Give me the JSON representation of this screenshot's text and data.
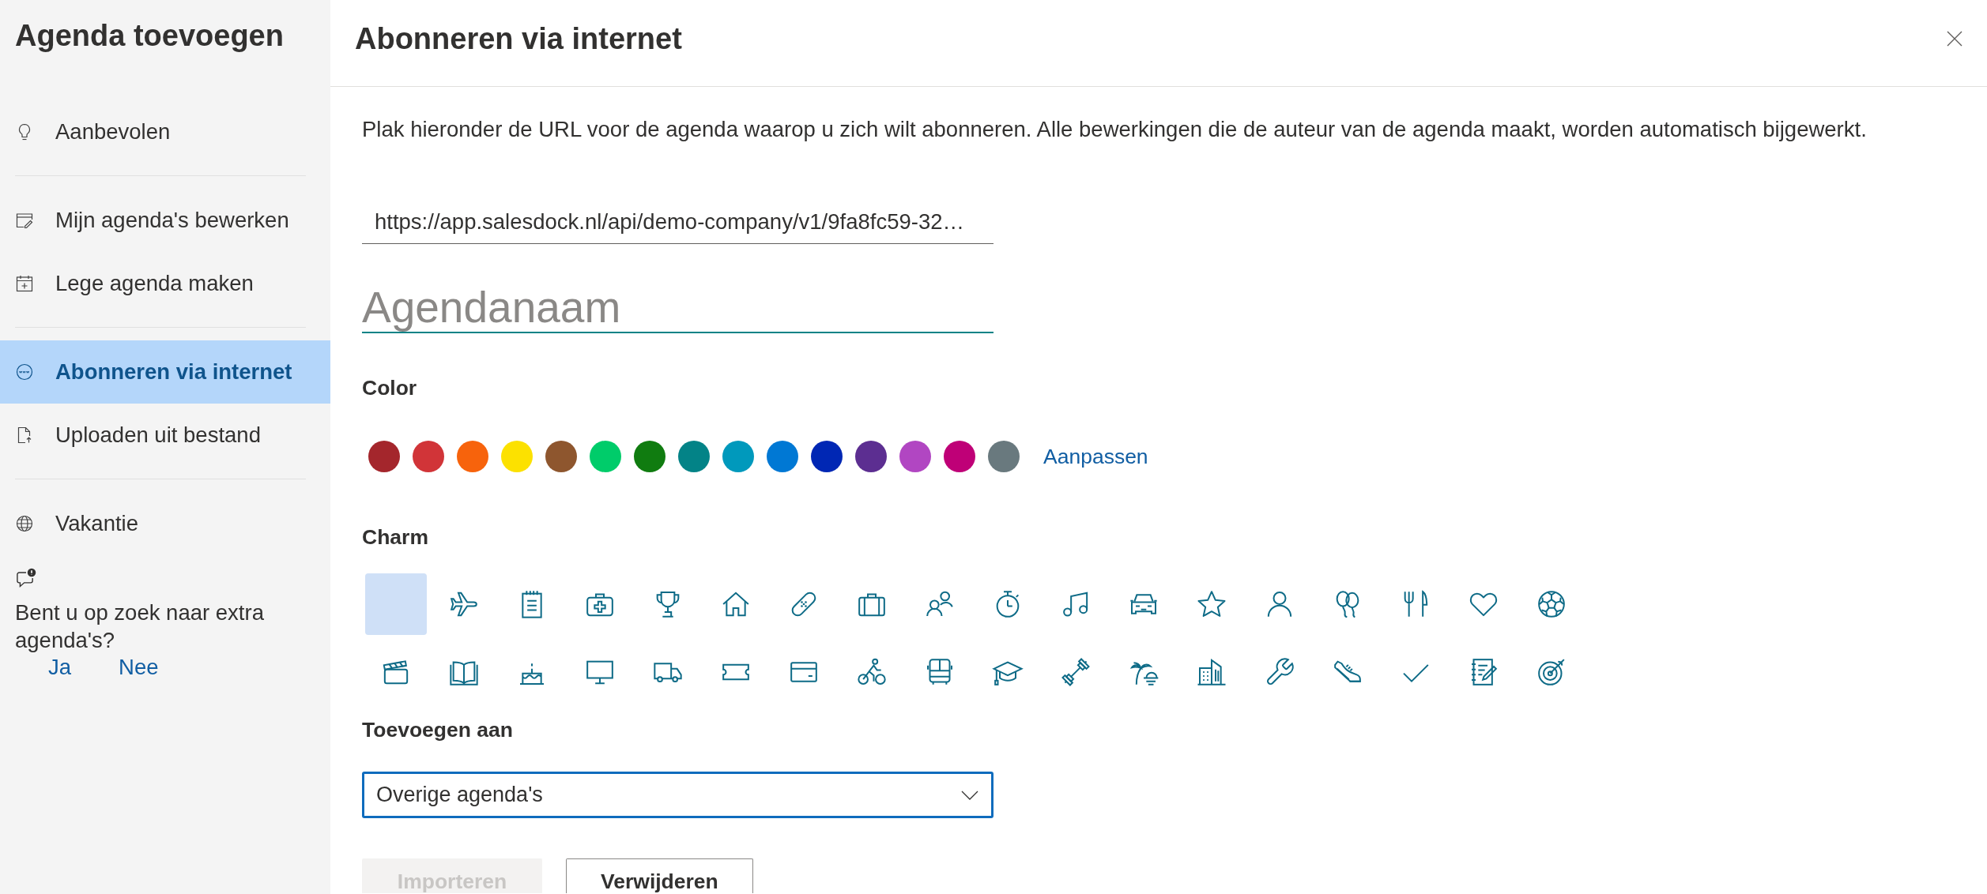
{
  "sidebar": {
    "title": "Agenda toevoegen",
    "groups": [
      {
        "items": [
          {
            "label": "Aanbevolen",
            "selected": false
          }
        ]
      },
      {
        "items": [
          {
            "label": "Mijn agenda's bewerken",
            "selected": false
          },
          {
            "label": "Lege agenda maken",
            "selected": false
          }
        ]
      },
      {
        "items": [
          {
            "label": "Abonneren via internet",
            "selected": true
          },
          {
            "label": "Uploaden uit bestand",
            "selected": false
          }
        ]
      },
      {
        "items": [
          {
            "label": "Vakantie",
            "selected": false
          }
        ]
      }
    ],
    "feedback": {
      "question": "Bent u op zoek naar extra agenda's?",
      "answers": [
        "Ja",
        "Nee"
      ]
    }
  },
  "panel": {
    "title": "Abonneren via internet",
    "description": "Plak hieronder de URL voor de agenda waarop u zich wilt abonneren. Alle bewerkingen die de auteur van de agenda maakt, worden automatisch bijgewerkt.",
    "url_field": {
      "value": "https://app.salesdock.nl/api/demo-company/v1/9fa8fc59-32…"
    },
    "name_field": {
      "placeholder": "Agendanaam"
    },
    "color": {
      "label": "Color",
      "swatches": [
        {
          "color": "#a4262c",
          "selected": false
        },
        {
          "color": "#d13438",
          "selected": false
        },
        {
          "color": "#f7630c",
          "selected": false
        },
        {
          "color": "#fce100",
          "selected": false
        },
        {
          "color": "#8e562e",
          "selected": false
        },
        {
          "color": "#00cc6a",
          "selected": false
        },
        {
          "color": "#107c10",
          "selected": false
        },
        {
          "color": "#038387",
          "selected": false
        },
        {
          "color": "#0099bc",
          "selected": false
        },
        {
          "color": "#0078d4",
          "selected": false
        },
        {
          "color": "#0027b4",
          "selected": false
        },
        {
          "color": "#5c2e91",
          "selected": false
        },
        {
          "color": "#b146c2",
          "selected": false
        },
        {
          "color": "#bf0077",
          "selected": false
        },
        {
          "color": "#69797e",
          "selected": false
        }
      ],
      "custom_link": "Aanpassen"
    },
    "charm": {
      "label": "Charm",
      "options": [
        {
          "selected": true
        },
        {
          "selected": false
        },
        {
          "selected": false
        },
        {
          "selected": false
        },
        {
          "selected": false
        },
        {
          "selected": false
        },
        {
          "selected": false
        },
        {
          "selected": false
        },
        {
          "selected": false
        },
        {
          "selected": false
        },
        {
          "selected": false
        },
        {
          "selected": false
        },
        {
          "selected": false
        },
        {
          "selected": false
        },
        {
          "selected": false
        },
        {
          "selected": false
        },
        {
          "selected": false
        },
        {
          "selected": false
        },
        {
          "selected": false
        },
        {
          "selected": false
        },
        {
          "selected": false
        },
        {
          "selected": false
        },
        {
          "selected": false
        },
        {
          "selected": false
        },
        {
          "selected": false
        },
        {
          "selected": false
        },
        {
          "selected": false
        },
        {
          "selected": false
        },
        {
          "selected": false
        },
        {
          "selected": false
        },
        {
          "selected": false
        },
        {
          "selected": false
        },
        {
          "selected": false
        },
        {
          "selected": false
        },
        {
          "selected": false
        },
        {
          "selected": false
        }
      ]
    },
    "add_to": {
      "label": "Toevoegen aan",
      "dropdown": {
        "value": "Overige agenda's"
      }
    },
    "buttons": [
      {
        "label": "Importeren",
        "kind": "primary",
        "disabled": true
      },
      {
        "label": "Verwijderen",
        "kind": "secondary",
        "disabled": false
      }
    ]
  }
}
